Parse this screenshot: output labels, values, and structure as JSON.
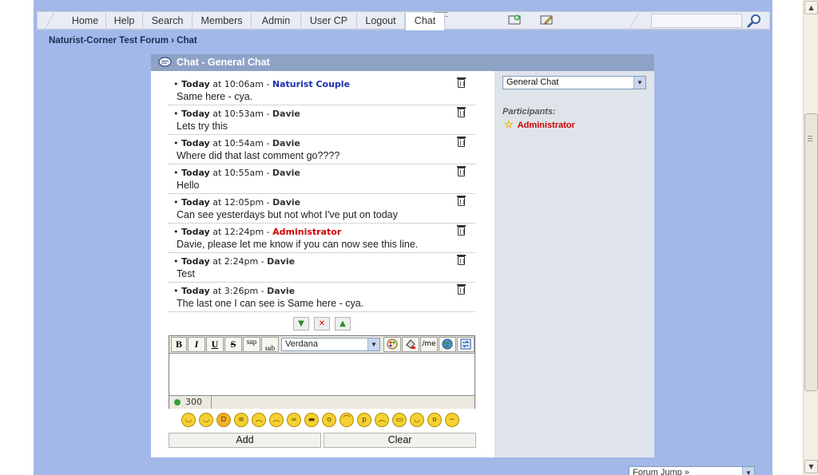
{
  "nav": {
    "tabs": [
      {
        "label": "Home"
      },
      {
        "label": "Help"
      },
      {
        "label": "Search"
      },
      {
        "label": "Members"
      },
      {
        "label": "Admin"
      },
      {
        "label": "User CP"
      },
      {
        "label": "Logout"
      },
      {
        "label": "Chat"
      }
    ],
    "active_tab": "Chat",
    "icons": [
      "new-post-icon",
      "edit-icon",
      "search-icon"
    ]
  },
  "breadcrumb": "Naturist-Corner Test Forum › Chat",
  "chat": {
    "title": "Chat - General Chat",
    "messages": [
      {
        "day": "Today",
        "time": "at 10:06am -",
        "user": "Naturist Couple",
        "text": "Same here - cya."
      },
      {
        "day": "Today",
        "time": "at 10:53am -",
        "user": "Davie",
        "text": "Lets try this"
      },
      {
        "day": "Today",
        "time": "at 10:54am -",
        "user": "Davie",
        "text": "Where did that last comment go????"
      },
      {
        "day": "Today",
        "time": "at 10:55am -",
        "user": "Davie",
        "text": "Hello"
      },
      {
        "day": "Today",
        "time": "at 12:05pm -",
        "user": "Davie",
        "text": "Can see yesterdays but not whot I've put on today"
      },
      {
        "day": "Today",
        "time": "at 12:24pm -",
        "user": "Administrator",
        "text": "Davie, please let me know if you can now see this line."
      },
      {
        "day": "Today",
        "time": "at 2:24pm -",
        "user": "Davie",
        "text": "Test"
      },
      {
        "day": "Today",
        "time": "at 3:26pm -",
        "user": "Davie",
        "text": "The last one I can see is Same here - cya."
      }
    ],
    "user_colors": {
      "Naturist Couple": "#1a2fb0",
      "Administrator": "#d00000",
      "Davie": "#333333"
    },
    "toolbar": {
      "bold": "B",
      "italic": "I",
      "underline": "U",
      "strike": "S",
      "sup": "sup",
      "sub": "sub",
      "font": "Verdana",
      "me": "/me"
    },
    "char_count": "300",
    "add_label": "Add",
    "clear_label": "Clear"
  },
  "sidebar": {
    "room_select": "General Chat",
    "participants_label": "Participants:",
    "participants": [
      "Administrator"
    ]
  },
  "forum_jump": "Forum Jump »",
  "colors": {
    "page_bg": "#a2b8e8",
    "header_bg": "#8ea2c6",
    "side_bg": "#dfe4ea"
  }
}
